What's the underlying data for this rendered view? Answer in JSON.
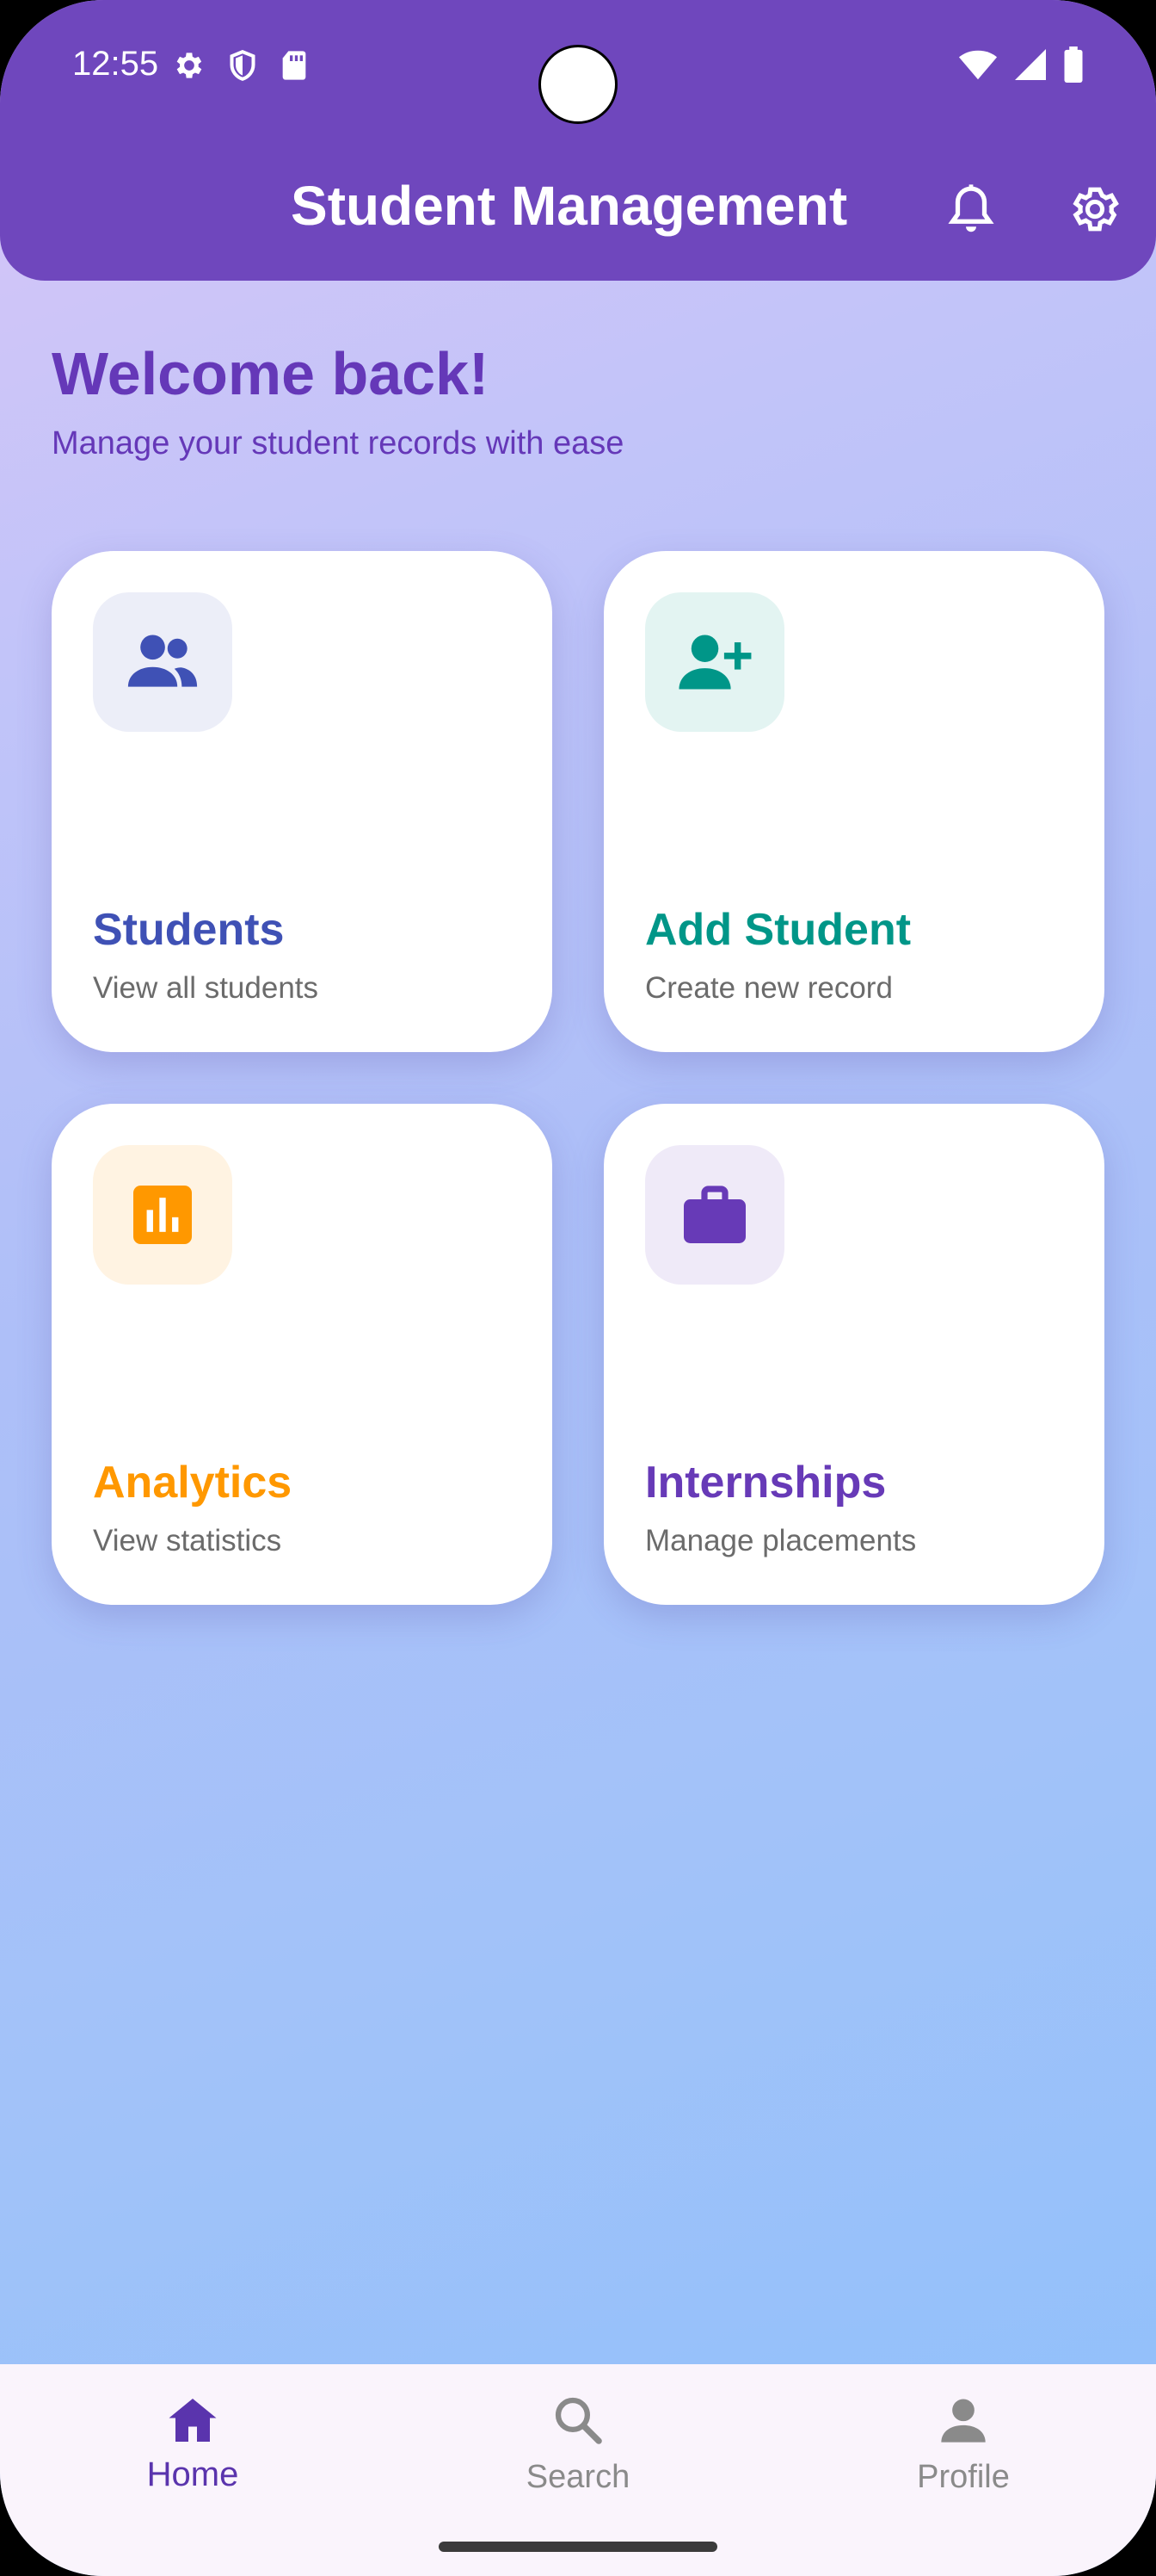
{
  "status_bar": {
    "time": "12:55",
    "left_icons": [
      "settings-icon",
      "shield-icon",
      "sd-card-icon"
    ],
    "right_icons": [
      "wifi-icon",
      "signal-icon",
      "battery-icon"
    ]
  },
  "app_bar": {
    "title": "Student Management",
    "actions": [
      "bell-icon",
      "gear-icon"
    ],
    "background": "#6f47bd"
  },
  "welcome": {
    "title": "Welcome back!",
    "subtitle": "Manage your student records with ease"
  },
  "cards": [
    {
      "title": "Students",
      "subtitle": "View all students",
      "icon": "people-icon",
      "color": "#3f51b5",
      "icon_bg": "#eceef8"
    },
    {
      "title": "Add Student",
      "subtitle": "Create new record",
      "icon": "person-add-icon",
      "color": "#009688",
      "icon_bg": "#e3f4f2"
    },
    {
      "title": "Analytics",
      "subtitle": "View statistics",
      "icon": "bar-chart-icon",
      "color": "#ff9800",
      "icon_bg": "#fff3e2"
    },
    {
      "title": "Internships",
      "subtitle": "Manage placements",
      "icon": "briefcase-icon",
      "color": "#673ab7",
      "icon_bg": "#efeaf8"
    }
  ],
  "bottom_nav": {
    "items": [
      {
        "label": "Home",
        "icon": "home-icon",
        "active": true
      },
      {
        "label": "Search",
        "icon": "search-icon",
        "active": false
      },
      {
        "label": "Profile",
        "icon": "person-icon",
        "active": false
      }
    ],
    "active_color": "#5a34ad",
    "inactive_color": "#8a8a8a"
  }
}
